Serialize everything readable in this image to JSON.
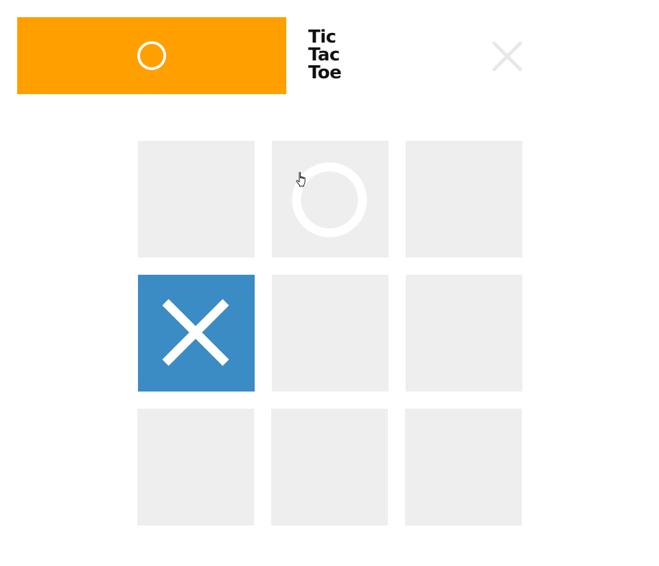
{
  "header": {
    "current_turn": "O",
    "title_lines": [
      "Tic",
      "Tac",
      "Toe"
    ],
    "reset_icon": "close-icon"
  },
  "colors": {
    "turn_bar": "#ffa000",
    "x_cell": "#3b8bc4",
    "empty_cell": "#eeeeee",
    "mark": "#ffffff",
    "reset_icon": "#e8e8e8"
  },
  "board": {
    "cells": [
      "",
      "O",
      "",
      "X",
      "",
      "",
      "",
      "",
      ""
    ]
  }
}
